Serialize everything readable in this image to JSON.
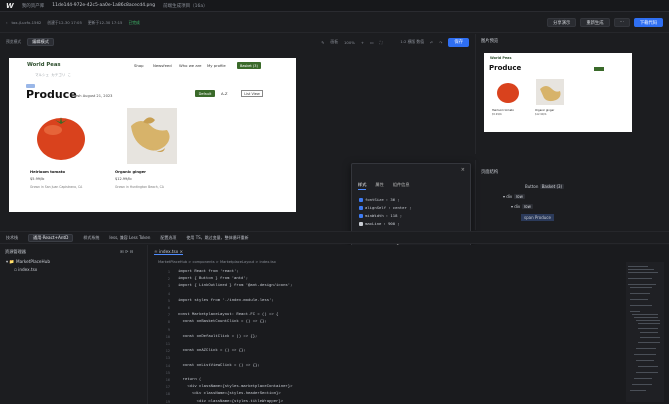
{
  "topbar": {
    "logo": "W",
    "breadcrumb": "我的资产库",
    "filename": "11de144-972e-42c5-aa0e-1a86c8acecd4.png",
    "project": "前端生成项目（16a）"
  },
  "subbar": {
    "branch": "tox-/Lucfx-1562",
    "created": "创建于12-30 17:05",
    "updated": "更新于12-30 17:15",
    "status": "已完成",
    "share_label": "分享演示",
    "regenerate_label": "重新生成",
    "download_label": "下载代码"
  },
  "canvas_toolbar": {
    "mode_label": "预览模式",
    "edit_mode_label": "编辑模式",
    "canvas_label": "画板",
    "zoom": "100%",
    "viewport": "1:2 横版 数值",
    "save_label": "保存"
  },
  "artboard": {
    "brand": "World Peas",
    "nav": [
      "Shop",
      "Newsfeed",
      "Who we are",
      "My profile"
    ],
    "basket": "Basket (3)",
    "subtitle": [
      "マルシェ",
      "カテゴリ",
      "こ"
    ],
    "title": "Produce",
    "date": "Fresh August 21, 2023",
    "default_label": "Default",
    "pager": "A-Z",
    "list_view": "List View",
    "cards": [
      {
        "name": "Heirloom tomato",
        "price": "$5.99/lb",
        "origin": "Grown in San Juan Capistrano, CA"
      },
      {
        "name": "Organic ginger",
        "price": "$12.99/lb",
        "origin": "Grown in Huntington Beach, CA"
      }
    ]
  },
  "preview_panel": {
    "title": "图片预览",
    "brand": "World Peas",
    "heading": "Produce",
    "cards": [
      {
        "name": "Heirloom tomato",
        "price": "$5.99/lb"
      },
      {
        "name": "Organic ginger",
        "price": "$12.99/lb"
      }
    ]
  },
  "structure": {
    "title": "页面结构",
    "items": [
      "Button",
      "Basket (3)",
      "div",
      "row",
      "div",
      "row",
      "span",
      "Produce"
    ]
  },
  "popover": {
    "tabs": [
      "样式",
      "属性",
      "组件信息"
    ],
    "props": [
      {
        "name": "fontSize",
        "value": ": 36 ;",
        "on": true
      },
      {
        "name": "alignSelf",
        "value": ": center ;",
        "on": true
      },
      {
        "name": "minWidth",
        "value": ": 118 ;",
        "on": true
      },
      {
        "name": "maxLine",
        "value": ": 900 ;",
        "on": false
      }
    ]
  },
  "midbar": {
    "items": [
      "技术栈",
      "通用·React+AntD",
      "样式系统",
      "less, 兼容 Less Token",
      "配置选项",
      "使用 TS，跳过变量，整体循环重新"
    ]
  },
  "filetree": {
    "title": "资源管理器",
    "folder": "MarketPlaceHub",
    "file": "index.tsx"
  },
  "editor": {
    "tab": "index.tsx",
    "breadcrumb": "MarketPlaceHub > components > MarketplaceLayout > index.tsx",
    "lines": [
      {
        "n": "1",
        "code": "import React from 'react';"
      },
      {
        "n": "2",
        "code": "import { Button } from 'antd';"
      },
      {
        "n": "3",
        "code": "import { LinkOutlined } from '@ant-design/icons';"
      },
      {
        "n": "4",
        "code": ""
      },
      {
        "n": "5",
        "code": "import styles from './index.module.less';"
      },
      {
        "n": "6",
        "code": ""
      },
      {
        "n": "7",
        "code": "const MarketplaceLayout: React.FC = () => {"
      },
      {
        "n": "8",
        "code": "  const onBasketCountClick = () => {};"
      },
      {
        "n": "9",
        "code": ""
      },
      {
        "n": "10",
        "code": "  const onDefaultClick = () => {};"
      },
      {
        "n": "11",
        "code": ""
      },
      {
        "n": "12",
        "code": "  const onAZClick = () => {};"
      },
      {
        "n": "13",
        "code": ""
      },
      {
        "n": "14",
        "code": "  const onListViewClick = () => {};"
      },
      {
        "n": "15",
        "code": ""
      },
      {
        "n": "16",
        "code": "  return ("
      },
      {
        "n": "17",
        "code": "    <div className={styles.marketplaceContainer}>"
      },
      {
        "n": "18",
        "code": "      <div className={styles.headerSection}>"
      },
      {
        "n": "19",
        "code": "        <div className={styles.titleWrapper}>"
      },
      {
        "n": "20",
        "code": "          <span className={styles.title}>World Peas</span>"
      }
    ]
  }
}
